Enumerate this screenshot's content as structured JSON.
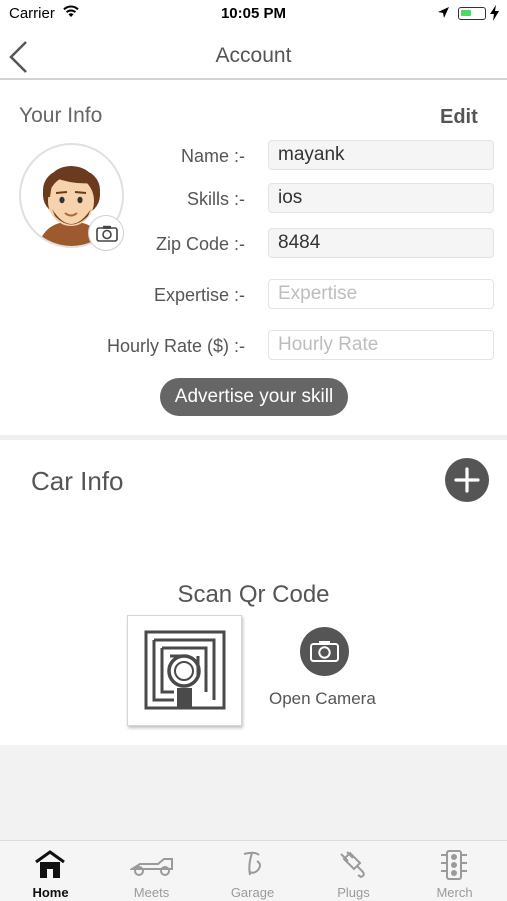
{
  "status_bar": {
    "carrier": "Carrier",
    "time": "10:05 PM"
  },
  "nav": {
    "title": "Account"
  },
  "your_info": {
    "heading": "Your Info",
    "edit_label": "Edit",
    "fields": {
      "name": {
        "label": "Name :-",
        "value": "mayank"
      },
      "skills": {
        "label": "Skills :-",
        "value": "ios"
      },
      "zip": {
        "label": "Zip Code :-",
        "value": "8484"
      },
      "expertise": {
        "label": "Expertise :-",
        "placeholder": "Expertise"
      },
      "hourly_rate": {
        "label": "Hourly Rate ($) :-",
        "placeholder": "Hourly Rate"
      }
    },
    "advertise_label": "Advertise your skill"
  },
  "car_info": {
    "heading": "Car Info",
    "scan_title": "Scan Qr Code",
    "open_camera_label": "Open Camera"
  },
  "tabs": [
    {
      "label": "Home",
      "icon": "house-icon",
      "active": true
    },
    {
      "label": "Meets",
      "icon": "race-car-icon",
      "active": false
    },
    {
      "label": "Garage",
      "icon": "garage-logo-icon",
      "active": false
    },
    {
      "label": "Plugs",
      "icon": "plug-icon",
      "active": false
    },
    {
      "label": "Merch",
      "icon": "traffic-light-icon",
      "active": false
    }
  ],
  "colors": {
    "accent_dark": "#555555",
    "battery_green": "#4cd964",
    "background": "#f2f2f2"
  }
}
